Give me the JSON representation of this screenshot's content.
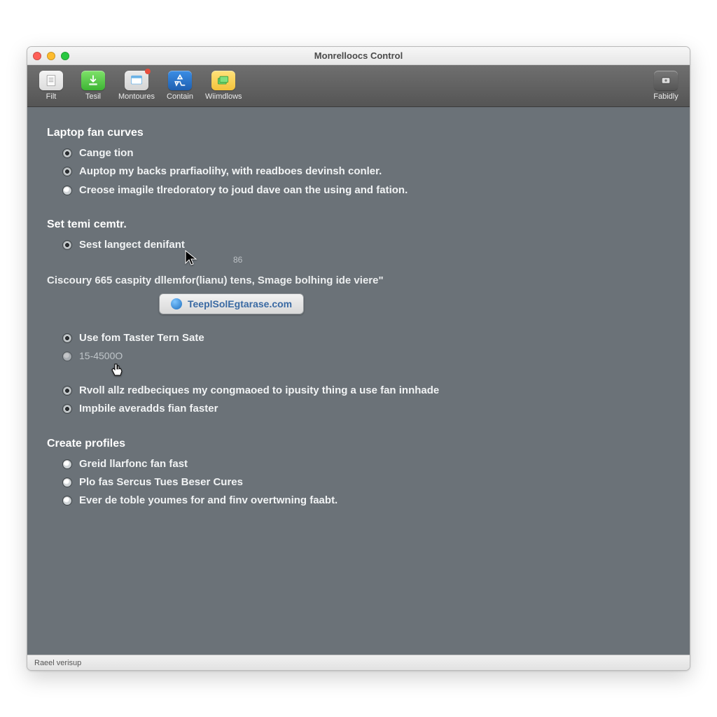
{
  "window": {
    "title": "Monrelloocs Control"
  },
  "toolbar": {
    "items": [
      {
        "label": "Filt"
      },
      {
        "label": "Tesil"
      },
      {
        "label": "Montoures"
      },
      {
        "label": "Contain"
      },
      {
        "label": "Wiimdlows"
      }
    ],
    "right": {
      "label": "Fabidly"
    }
  },
  "sections": {
    "fan_curves": {
      "title": "Laptop fan curves",
      "options": [
        {
          "label": "Cange tion",
          "selected": true
        },
        {
          "label": "Auptop my backs prarfiaolihy, with readboes devinsh conler.",
          "selected": true
        },
        {
          "label": "Creose imagile tlredoratory to joud dave oan the using and fation.",
          "selected": false
        }
      ]
    },
    "set_temp": {
      "title": "Set temi cemtr.",
      "option": {
        "label": "Sest langect denifant",
        "selected": true
      },
      "sub_value": "86"
    },
    "ciscoury": {
      "desc": "Ciscoury 665 caspity dllemfor(lianu) tens, Smage bolhing ide viere\"",
      "button": "TeeplSolEgtarase.com"
    },
    "use_from": {
      "options": [
        {
          "label": "Use fom Taster Tern Sate",
          "selected": true
        },
        {
          "label": "15-4500O",
          "selected": false,
          "dim": true
        },
        {
          "label": "Rvoll allz redbeciques my congmaoed to ipusity thing a use fan innhade",
          "selected": true
        },
        {
          "label": "Impbile averadds fian faster",
          "selected": true
        }
      ]
    },
    "profiles": {
      "title": "Create profiles",
      "options": [
        {
          "label": "Greid llarfonc fan fast",
          "selected": false
        },
        {
          "label": "Plo fas Sercus Tues Beser Cures",
          "selected": false
        },
        {
          "label": "Ever de toble youmes for and finv overtwning faabt.",
          "selected": false
        }
      ]
    }
  },
  "statusbar": {
    "text": "Raeel verisup"
  }
}
